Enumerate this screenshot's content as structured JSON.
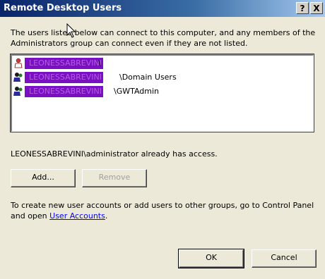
{
  "window": {
    "title": "Remote Desktop Users",
    "help_label": "?",
    "close_label": "X"
  },
  "intro_text": "The users listed below can connect to this computer, and any members of the Administrators group can connect even if they are not listed.",
  "users": [
    {
      "domain": "LEONESSABREVINI",
      "suffix": "\\"
    },
    {
      "domain": "LEONESSABREVINI",
      "suffix": "\\Domain Users"
    },
    {
      "domain": "LEONESSABREVINI",
      "suffix": "\\GWTAdmin"
    }
  ],
  "access_text": "LEONESSABREVINI\\administrator already has access.",
  "buttons": {
    "add": "Add...",
    "remove": "Remove",
    "ok": "OK",
    "cancel": "Cancel"
  },
  "footer": {
    "text_before": "To create new user accounts or add users to other groups, go to Control Panel and open ",
    "link": "User Accounts",
    "text_after": "."
  },
  "colors": {
    "redaction": "#7a0fc4",
    "link": "#0000ff",
    "title_bar": "#0a246a"
  }
}
